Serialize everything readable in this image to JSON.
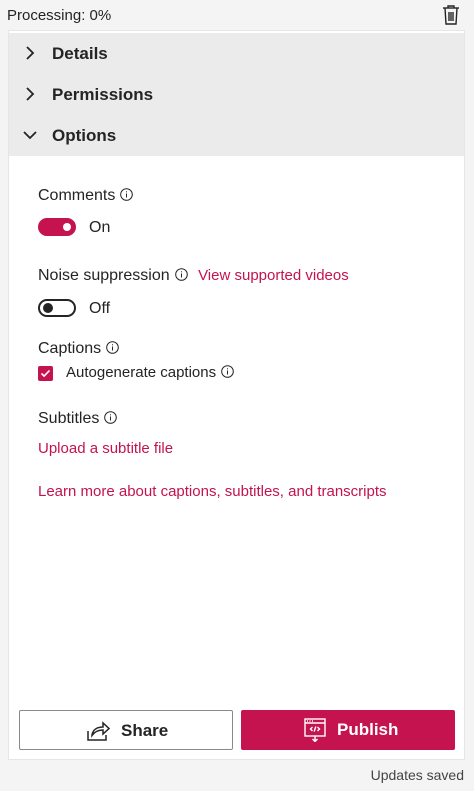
{
  "header": {
    "processing_text": "Processing: 0%",
    "delete_icon": "trash-icon"
  },
  "accordion": {
    "details_label": "Details",
    "permissions_label": "Permissions",
    "options_label": "Options"
  },
  "options": {
    "comments": {
      "label": "Comments",
      "toggle_state_text": "On",
      "enabled": true
    },
    "noise_suppression": {
      "label": "Noise suppression",
      "link_text": "View supported videos",
      "toggle_state_text": "Off",
      "enabled": false
    },
    "captions": {
      "label": "Captions",
      "checkbox_label": "Autogenerate captions",
      "checked": true
    },
    "subtitles": {
      "label": "Subtitles",
      "upload_link": "Upload a subtitle file"
    },
    "learn_more_link": "Learn more about captions, subtitles, and transcripts"
  },
  "actions": {
    "share_label": "Share",
    "publish_label": "Publish"
  },
  "footer": {
    "status_text": "Updates saved"
  },
  "colors": {
    "accent": "#c4134f",
    "header_bg": "#ebebeb",
    "text": "#252424"
  }
}
